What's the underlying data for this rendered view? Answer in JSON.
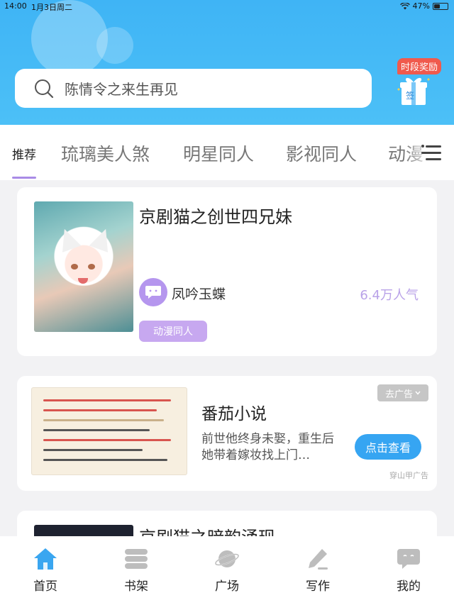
{
  "status": {
    "time": "14:00",
    "date": "1月3日周二",
    "battery": "47%",
    "battery_level": 0.47
  },
  "search": {
    "placeholder": "陈情令之来生再见"
  },
  "reward": {
    "badge": "时段奖励",
    "gift_label": "签"
  },
  "tabs": {
    "items": [
      {
        "label": "推荐",
        "active": true
      },
      {
        "label": "琉璃美人煞"
      },
      {
        "label": "明星同人"
      },
      {
        "label": "影视同人"
      },
      {
        "label": "动漫"
      }
    ]
  },
  "feed": {
    "book1": {
      "title": "京剧猫之创世四兄妹",
      "author": "凤吟玉蝶",
      "popularity": "6.4万人气",
      "tag": "动漫同人"
    },
    "ad": {
      "title": "番茄小说",
      "description": "前世他终身未娶，重生后她带着嫁妆找上门…",
      "button": "点击查看",
      "close_label": "去广告",
      "source": "穿山甲广告"
    },
    "book3": {
      "title": "京剧猫之暗韵涌现"
    }
  },
  "bottom_nav": {
    "items": [
      {
        "label": "首页",
        "icon": "home-icon",
        "active": true
      },
      {
        "label": "书架",
        "icon": "bookshelf-icon"
      },
      {
        "label": "广场",
        "icon": "planet-icon"
      },
      {
        "label": "写作",
        "icon": "pen-icon"
      },
      {
        "label": "我的",
        "icon": "chat-bubble-icon"
      }
    ]
  },
  "colors": {
    "header": "#3fb4f5",
    "accent_purple": "#b596ee",
    "button_blue": "#36a5f2",
    "reward_red": "#f05a4d",
    "active_nav_blue": "#3aa6f0",
    "inactive_icon": "#bdbdbd"
  }
}
